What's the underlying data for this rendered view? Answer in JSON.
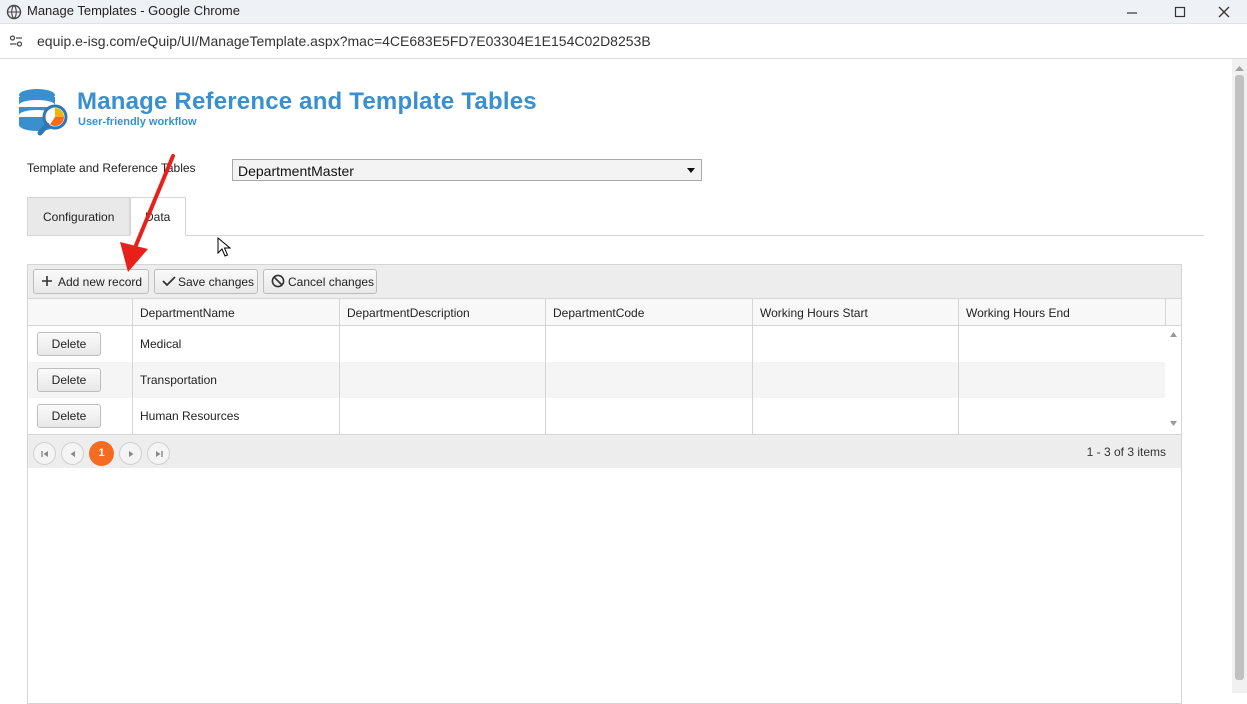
{
  "window": {
    "title": "Manage Templates - Google Chrome",
    "url": "equip.e-isg.com/eQuip/UI/ManageTemplate.aspx?mac=4CE683E5FD7E03304E1E154C02D8253B"
  },
  "header": {
    "title": "Manage Reference and Template Tables",
    "subtitle": "User-friendly workflow"
  },
  "selector": {
    "label": "Template and Reference Tables",
    "value": "DepartmentMaster"
  },
  "tabs": [
    {
      "label": "Configuration",
      "active": false
    },
    {
      "label": "Data",
      "active": true
    }
  ],
  "toolbar": {
    "add_label": "Add new record",
    "save_label": "Save changes",
    "cancel_label": "Cancel changes"
  },
  "grid": {
    "columns": [
      "DepartmentName",
      "DepartmentDescription",
      "DepartmentCode",
      "Working Hours Start",
      "Working Hours End"
    ],
    "delete_label": "Delete",
    "rows": [
      {
        "name": "Medical"
      },
      {
        "name": "Transportation"
      },
      {
        "name": "Human Resources"
      }
    ]
  },
  "pager": {
    "current_page": "1",
    "info": "1 - 3 of 3 items"
  },
  "colors": {
    "accent": "#3a8fce",
    "pager_active": "#f36c21",
    "annotation_arrow": "#e8201c"
  }
}
